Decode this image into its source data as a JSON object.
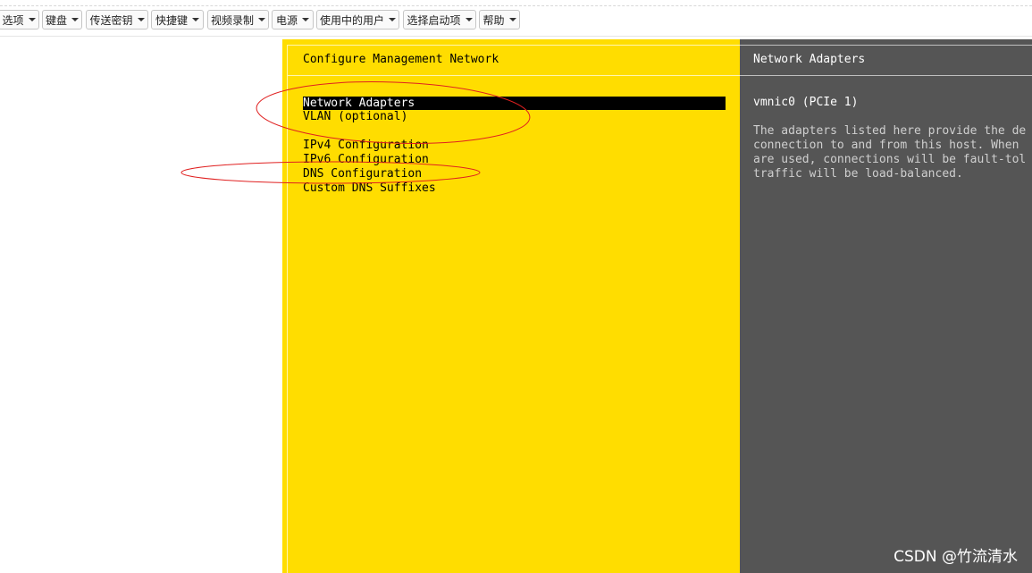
{
  "toolbar": {
    "buttons": [
      {
        "label": "选项"
      },
      {
        "label": "键盘"
      },
      {
        "label": "传送密钥"
      },
      {
        "label": "快捷键"
      },
      {
        "label": "视频录制"
      },
      {
        "label": "电源"
      },
      {
        "label": "使用中的用户"
      },
      {
        "label": "选择启动项"
      },
      {
        "label": "帮助"
      }
    ]
  },
  "console": {
    "left_title": "Configure Management Network",
    "menu_items": [
      {
        "label": "Network Adapters",
        "selected": true
      },
      {
        "label": "VLAN (optional)",
        "selected": false
      },
      {
        "label": "IPv4 Configuration",
        "selected": false
      },
      {
        "label": "IPv6 Configuration",
        "selected": false
      },
      {
        "label": "DNS Configuration",
        "selected": false
      },
      {
        "label": "Custom DNS Suffixes",
        "selected": false
      }
    ],
    "right_title": "Network Adapters",
    "adapter": "vmnic0 (PCIe 1)",
    "description_lines": [
      "The adapters listed here provide the de",
      "connection to and from this host. When ",
      "are used, connections will be fault-tol",
      "traffic will be load-balanced."
    ]
  },
  "watermark": "CSDN @竹流清水",
  "colors": {
    "console_left_bg": "#ffdd00",
    "console_right_bg": "#555555",
    "selected_bg": "#000000",
    "annotation": "#e02020"
  }
}
